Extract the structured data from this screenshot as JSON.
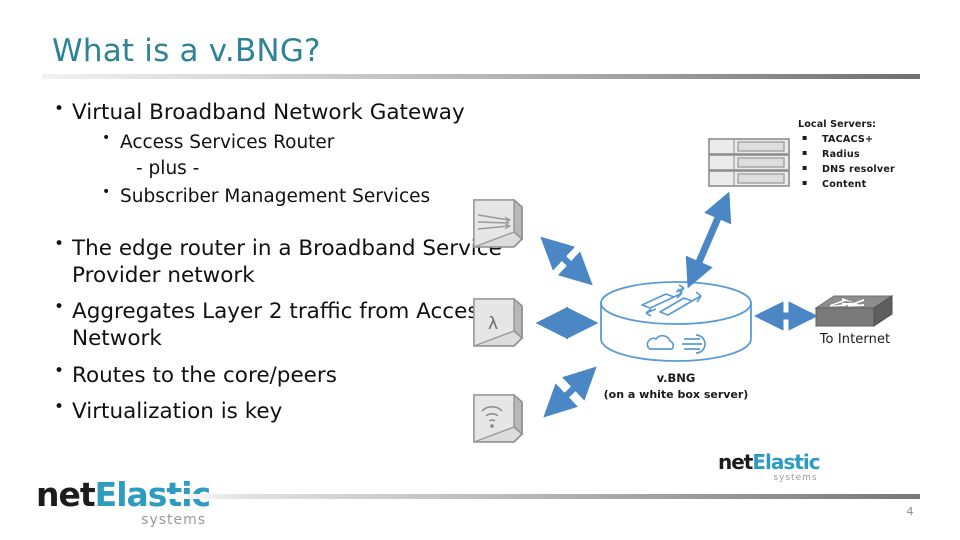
{
  "slide": {
    "title": "What is a v.BNG?",
    "page_number": "4",
    "title_color": "#2E8397",
    "arrow_color": "#4A87C4",
    "cloud_color": "#5B9BD5"
  },
  "bullets": {
    "level1_a": "Virtual Broadband Network Gateway",
    "level2_a": "Access Services Router",
    "level2_plus": "- plus -",
    "level2_b": "Subscriber Management Services",
    "level1_b": "The edge router in a Broadband Service Provider network",
    "level1_c": "Aggregates Layer 2 traffic from Access Network",
    "level1_d": "Routes to the core/peers",
    "level1_e": "Virtualization is key"
  },
  "diagram": {
    "servers": {
      "heading": "Local Servers:",
      "items": [
        "TACACS+",
        "Radius",
        "DNS resolver",
        "Content"
      ]
    },
    "vbng": {
      "name": "v.BNG",
      "subtitle": "(on a white box server)"
    },
    "internet_label": "To Internet",
    "access_devices": [
      {
        "icon": "ethernet-device-icon",
        "glyph": "lines"
      },
      {
        "icon": "lambda-device-icon",
        "glyph": "λ"
      },
      {
        "icon": "wifi-device-icon",
        "glyph": "wifi"
      }
    ]
  },
  "logo": {
    "part1": "net",
    "part2": "Elastic",
    "tagline": "systems"
  }
}
